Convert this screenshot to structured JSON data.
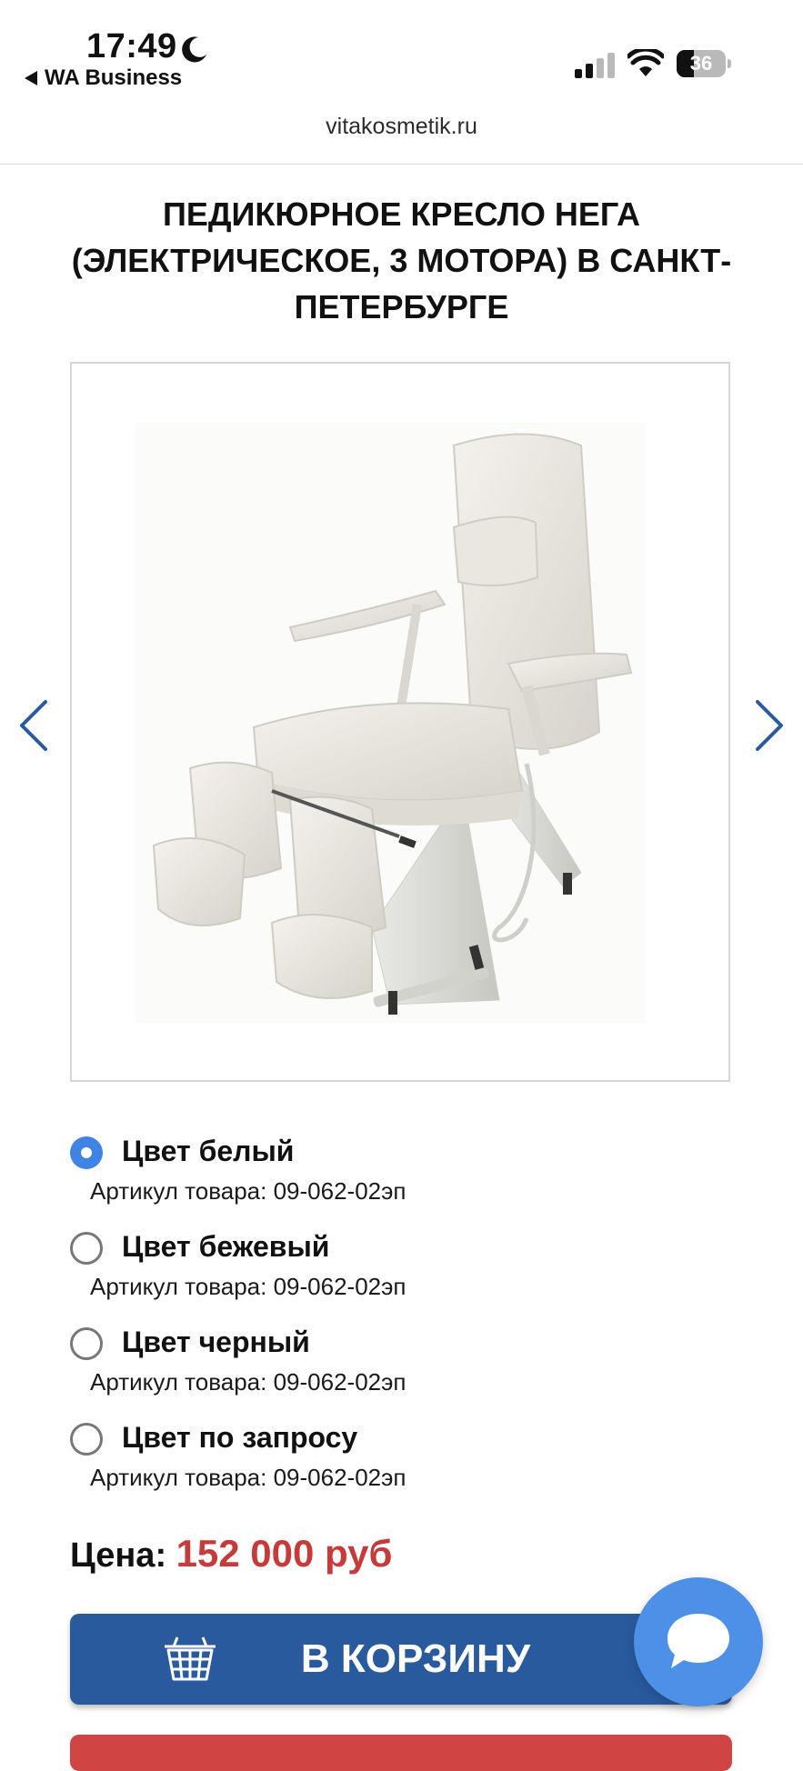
{
  "status_bar": {
    "time": "17:49",
    "back_app": "WA Business",
    "battery": "36",
    "battery_level": 0.36
  },
  "url_bar": {
    "domain": "vitakosmetik.ru"
  },
  "product": {
    "title": "Педикюрное кресло НЕГА (электрическое, 3 мотора) в Санкт-Петербурге"
  },
  "gallery": {
    "prev_icon": "chevron-left-icon",
    "next_icon": "chevron-right-icon"
  },
  "variants": [
    {
      "name": "Цвет белый",
      "sku": "Артикул товара: 09-062-02эп",
      "selected": true
    },
    {
      "name": "Цвет бежевый",
      "sku": "Артикул товара: 09-062-02эп",
      "selected": false
    },
    {
      "name": "Цвет черный",
      "sku": "Артикул товара: 09-062-02эп",
      "selected": false
    },
    {
      "name": "Цвет по запросу",
      "sku": "Артикул товара: 09-062-02эп",
      "selected": false
    }
  ],
  "price": {
    "label": "Цена:",
    "value": "152 000 руб"
  },
  "cart": {
    "label": "В КОРЗИНУ",
    "icon": "basket-icon"
  },
  "chat": {
    "icon": "chat-bubble-icon"
  },
  "colors": {
    "accent_blue": "#2a5a9e",
    "radio_selected": "#3f84e5",
    "price_red": "#c63a3a",
    "chat_fab": "#4d90e8",
    "secondary_button": "#d14444"
  }
}
